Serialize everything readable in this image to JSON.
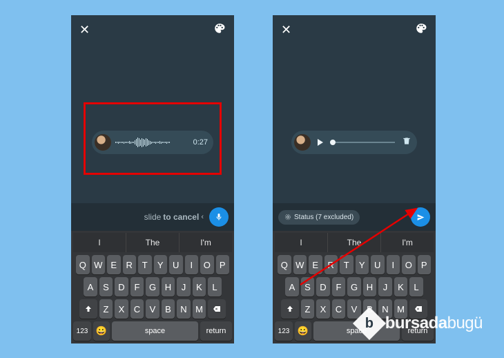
{
  "left": {
    "duration": "0:27",
    "slide_text": "slide",
    "cancel_text": "to cancel"
  },
  "right": {
    "status_text": "Status (7 excluded)"
  },
  "keyboard": {
    "suggestions": [
      "I",
      "The",
      "I'm"
    ],
    "row1": [
      "Q",
      "W",
      "E",
      "R",
      "T",
      "Y",
      "U",
      "I",
      "O",
      "P"
    ],
    "row2": [
      "A",
      "S",
      "D",
      "F",
      "G",
      "H",
      "J",
      "K",
      "L"
    ],
    "row3": [
      "Z",
      "X",
      "C",
      "V",
      "B",
      "N",
      "M"
    ],
    "num_key": "123",
    "space": "space",
    "return": "return"
  },
  "watermark": {
    "badge": "b",
    "bold": "bursada",
    "light": "bugü"
  }
}
